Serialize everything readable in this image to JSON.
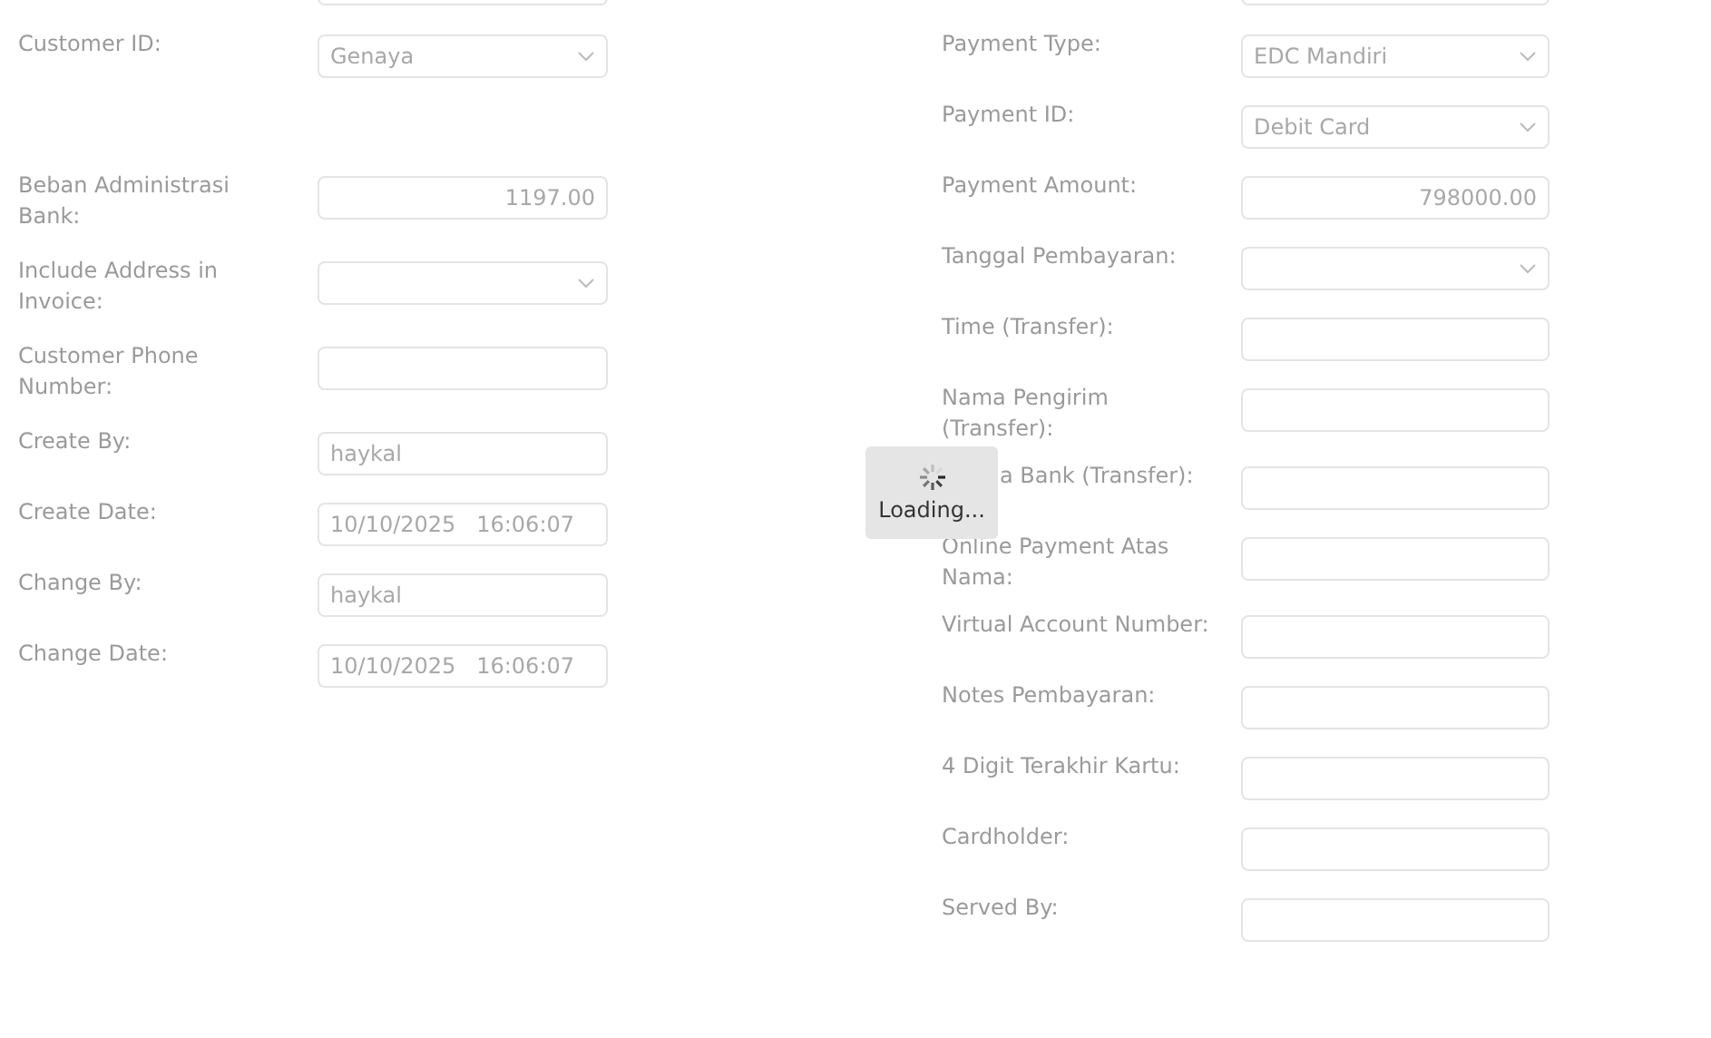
{
  "left_column": [
    {
      "kind": "cut"
    },
    {
      "kind": "select",
      "label": "Customer ID:",
      "value": "Genaya"
    },
    {
      "kind": "blank"
    },
    {
      "kind": "text",
      "label": "Beban Administrasi Bank:",
      "value": "1197.00",
      "numeric": true
    },
    {
      "kind": "select",
      "label": "Include Address in Invoice:"
    },
    {
      "kind": "text",
      "label": "Customer Phone Number:"
    },
    {
      "kind": "text",
      "label": "Create By:",
      "value": "haykal"
    },
    {
      "kind": "text",
      "label": "Create Date:",
      "value": "10/10/2025   16:06:07"
    },
    {
      "kind": "text",
      "label": "Change By:",
      "value": "haykal"
    },
    {
      "kind": "text",
      "label": "Change Date:",
      "value": "10/10/2025   16:06:07"
    }
  ],
  "right_column": [
    {
      "kind": "cut"
    },
    {
      "kind": "select",
      "label": "Payment Type:",
      "value": "EDC Mandiri"
    },
    {
      "kind": "select",
      "label": "Payment ID:",
      "value": "Debit Card"
    },
    {
      "kind": "text",
      "label": "Payment Amount:",
      "value": "798000.00",
      "numeric": true
    },
    {
      "kind": "select",
      "label": "Tanggal Pembayaran:"
    },
    {
      "kind": "text",
      "label": "Time (Transfer):"
    },
    {
      "kind": "text",
      "label": "Nama Pengirim (Transfer):"
    },
    {
      "kind": "text",
      "label": "a Bank (Transfer):",
      "partly_hidden": true
    },
    {
      "kind": "text",
      "label": "Online Payment Atas Nama:"
    },
    {
      "kind": "text",
      "label": "Virtual Account Number:"
    },
    {
      "kind": "text",
      "label": "Notes Pembayaran:"
    },
    {
      "kind": "text",
      "label": "4 Digit Terakhir Kartu:"
    },
    {
      "kind": "text",
      "label": "Cardholder:"
    },
    {
      "kind": "text",
      "label": "Served By:"
    }
  ],
  "loading": {
    "text": "Loading..."
  }
}
